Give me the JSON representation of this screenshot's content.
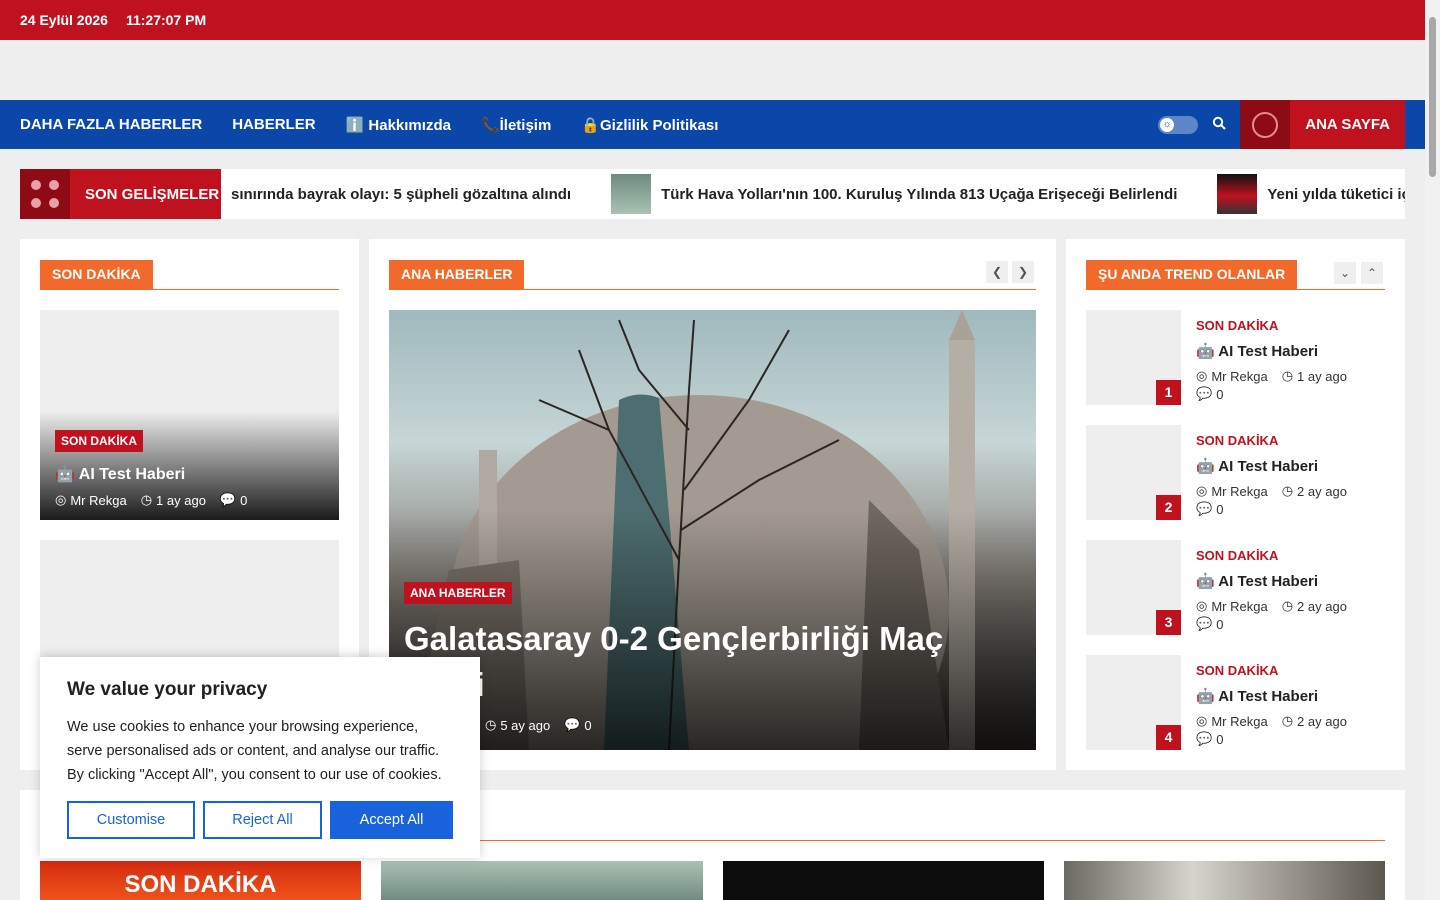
{
  "topbar": {
    "date": "24 Eylül 2026",
    "time": "11:27:07 PM"
  },
  "nav": {
    "items": [
      "DAHA FAZLA HABERLER",
      "HABERLER",
      "ℹ️ Hakkımızda",
      "📞İletişim",
      "🔒Gizlilik Politikası"
    ],
    "home": "ANA SAYFA"
  },
  "ticker": {
    "label": "SON GELİŞMELER",
    "items": [
      "sınırında bayrak olayı: 5 şüpheli gözaltına alındı",
      "Türk Hava Yolları'nın 100. Kuruluş Yılında 813 Uçağa Erişeceği Belirlendi",
      "Yeni yılda tüketici için ne d"
    ]
  },
  "left": {
    "heading": "SON DAKİKA",
    "post": {
      "category": "SON DAKİKA",
      "title": "🤖 AI Test Haberi",
      "author": "Mr Rekga",
      "time": "1 ay ago",
      "comments": "0"
    }
  },
  "center": {
    "heading": "ANA HABERLER",
    "post": {
      "category": "ANA HABERLER",
      "title": "Galatasaray 0-2 Gençlerbirliği Maç Özeti",
      "time": "5 ay ago",
      "comments": "0"
    }
  },
  "right": {
    "heading": "ŞU ANDA TREND OLANLAR",
    "items": [
      {
        "num": "1",
        "category": "SON DAKİKA",
        "title": "🤖 AI Test Haberi",
        "author": "Mr Rekga",
        "time": "1 ay ago",
        "comments": "0"
      },
      {
        "num": "2",
        "category": "SON DAKİKA",
        "title": "🤖 AI Test Haberi",
        "author": "Mr Rekga",
        "time": "2 ay ago",
        "comments": "0"
      },
      {
        "num": "3",
        "category": "SON DAKİKA",
        "title": "🤖 AI Test Haberi",
        "author": "Mr Rekga",
        "time": "2 ay ago",
        "comments": "0"
      },
      {
        "num": "4",
        "category": "SON DAKİKA",
        "title": "🤖 AI Test Haberi",
        "author": "Mr Rekga",
        "time": "2 ay ago",
        "comments": "0"
      }
    ]
  },
  "bottom": {
    "first_thumb_text": "SON DAKİKA"
  },
  "cookie": {
    "title": "We value your privacy",
    "text": "We use cookies to enhance your browsing experience, serve personalised ads or content, and analyse our traffic. By clicking \"Accept All\", you consent to our use of cookies.",
    "customise": "Customise",
    "reject": "Reject All",
    "accept": "Accept All"
  },
  "colors": {
    "brand_red": "#c0111f",
    "nav_blue": "#0a47a8",
    "accent_orange": "#f26a2b",
    "accept_blue": "#1863dc"
  }
}
